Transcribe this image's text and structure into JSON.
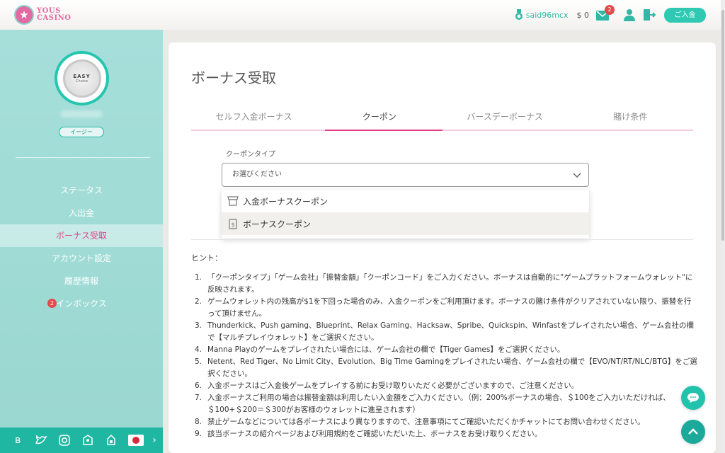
{
  "header": {
    "logo_line1": "YOUS",
    "logo_line2": "CASINO",
    "username": "said96mcx",
    "balance": "$ 0",
    "mail_count": "2",
    "deposit_label": "ご入金"
  },
  "sidebar": {
    "avatar_line1": "EASY",
    "avatar_line2": "Choice",
    "level": "イージー",
    "items": [
      {
        "label": "ステータス"
      },
      {
        "label": "入出金"
      },
      {
        "label": "ボーナス受取"
      },
      {
        "label": "アカウント設定"
      },
      {
        "label": "履歴情報"
      },
      {
        "label": "インボックス",
        "badge": "2"
      }
    ],
    "social_icons": [
      "blog-icon",
      "twitter-icon",
      "instagram-icon",
      "line-icon",
      "line-alt-icon",
      "japan-flag-icon"
    ]
  },
  "page": {
    "title": "ボーナス受取",
    "tabs": [
      "セルフ入金ボーナス",
      "クーポン",
      "バースデーボーナス",
      "賭け条件"
    ],
    "active_tab": "クーポン",
    "coupon_type_label": "クーポンタイプ",
    "select_placeholder": "お選びください",
    "options": [
      "入金ボーナスクーポン",
      "ボーナスクーポン"
    ],
    "hint_title": "ヒント：",
    "hints": [
      "「クーポンタイプ」「ゲーム会社」「振替金額」「クーポンコード」をご入力ください。ボーナスは自動的に\"ゲームプラットフォームウォレット\"に反映されます。",
      "ゲームウォレット内の残高が$1を下回った場合のみ、入金クーポンをご利用頂けます。ボーナスの賭け条件がクリアされていない限り、振替を行って頂けません。",
      "Thunderkick、Push gaming、Blueprint、Relax Gaming、Hacksaw、Spribe、Quickspin、Winfastをプレイされたい場合、ゲーム会社の欄で【マルチプレイウォレット】をご選択ください。",
      "Manna Playのゲームをプレイされたい場合には、ゲーム会社の欄で【Tiger Games】をご選択ください。",
      "Netent、Red Tiger、No Limit City、Evolution、Big Time Gamingをプレイされたい場合、ゲーム会社の欄で【EVO/NT/RT/NLC/BTG】をご選択ください。",
      "入金ボーナスはご入金後ゲームをプレイする前にお受け取りいただく必要がございますので、ご注意ください。",
      "入金ボーナスご利用の場合は振替金額は利用したい入金額をご入力ください。（例：200%ボーナスの場合、＄100をご入力いただければ、＄100+＄200＝＄300がお客様のウォレットに進呈されます）",
      "禁止ゲームなどについては各ボーナスにより異なりますので、注意事項にてご確認いただくかチャットにてお問い合わせください。",
      "該当ボーナスの紹介ページおよび利用規約をご確認いただいた上、ボーナスをお受け取りください。"
    ]
  },
  "colors": {
    "accent": "#1fb7a2",
    "active": "#e43f8b",
    "sidebar_bg": "#a6dfda"
  }
}
